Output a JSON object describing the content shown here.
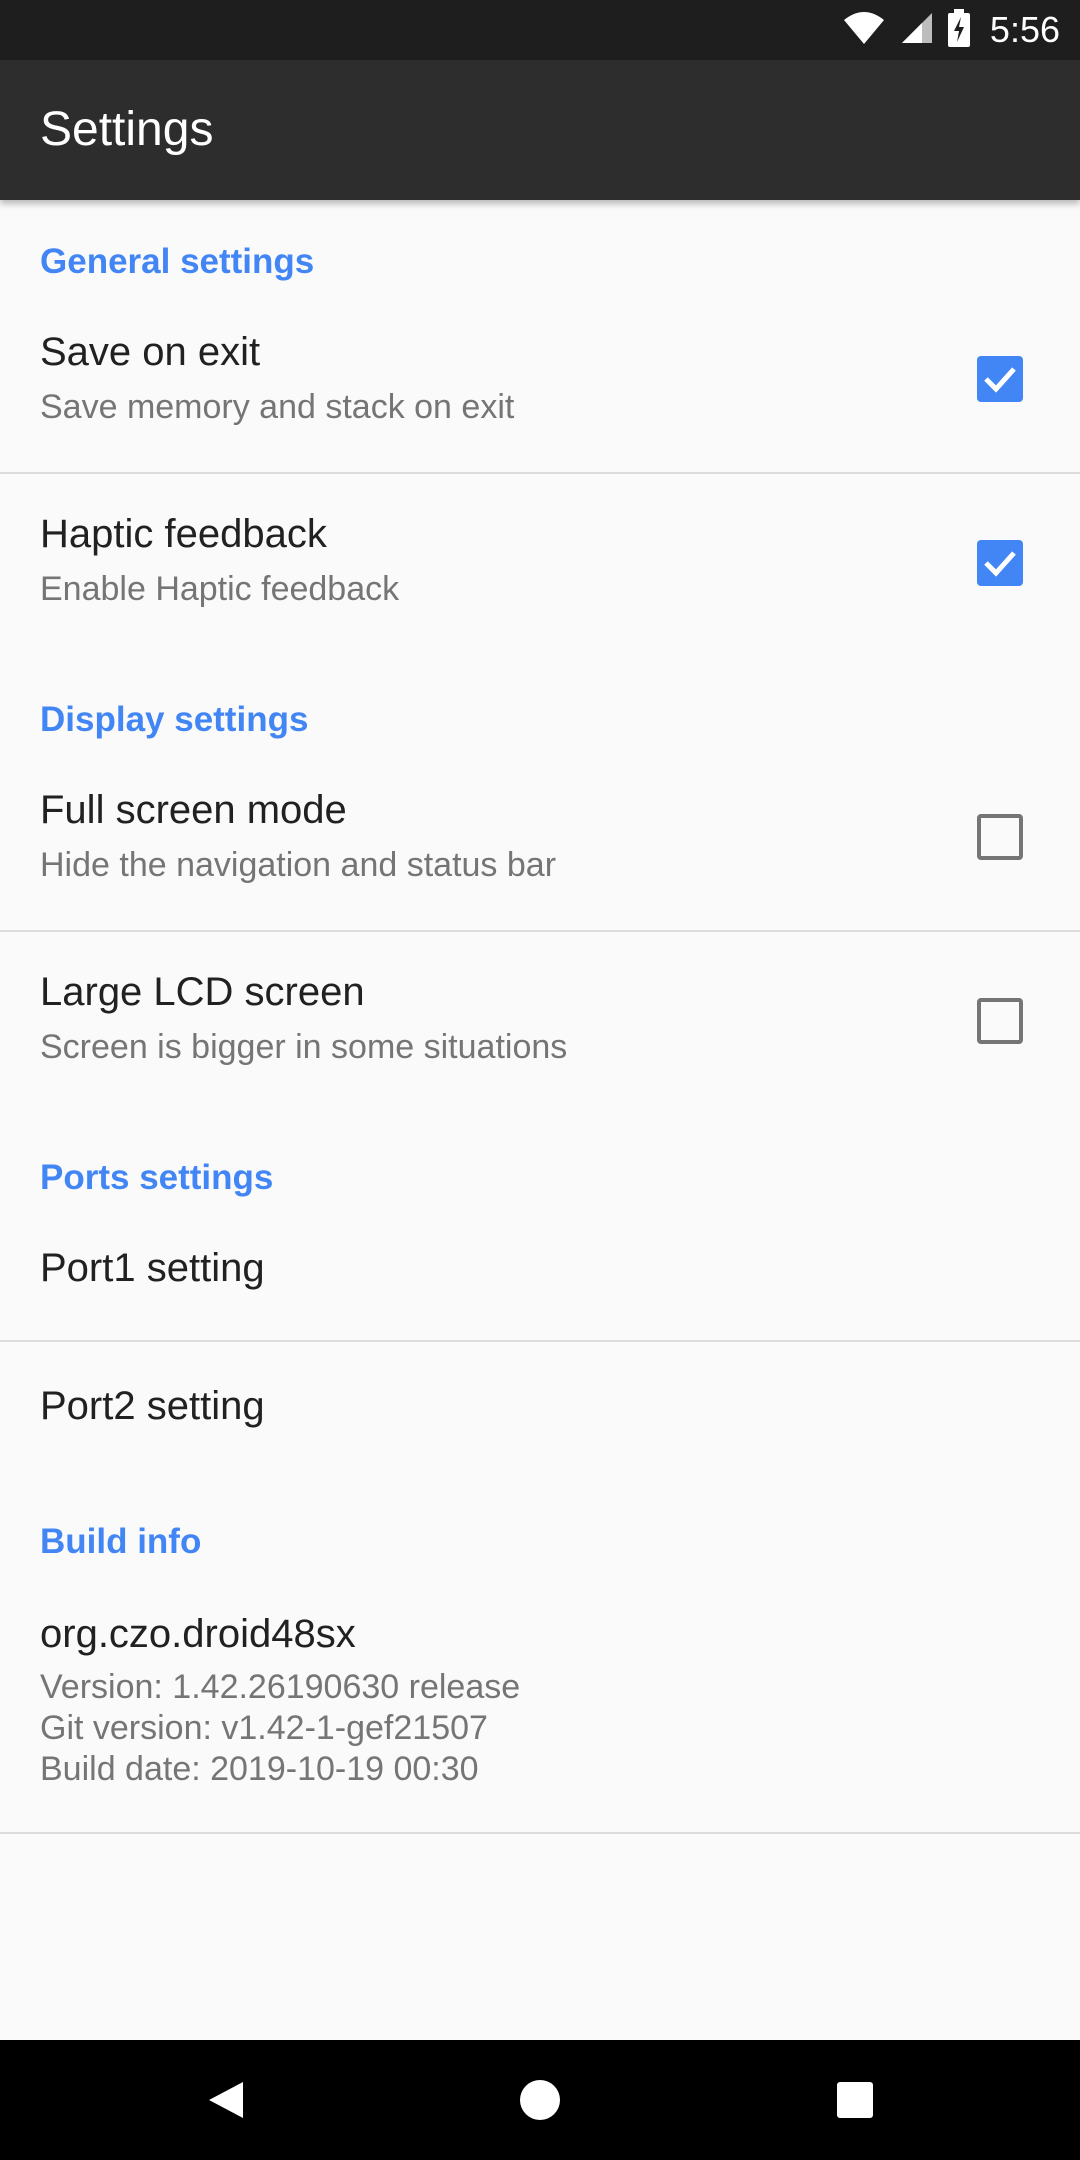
{
  "status_bar": {
    "time": "5:56",
    "icons": [
      "wifi-icon",
      "cell-signal-icon",
      "battery-charging-icon"
    ]
  },
  "app_bar": {
    "title": "Settings"
  },
  "colors": {
    "accent": "#4285f4",
    "app_bar": "#2d2d2d",
    "status_bar": "#1e1e1e",
    "background": "#fafafa"
  },
  "sections": {
    "general": {
      "header": "General settings",
      "save_on_exit": {
        "title": "Save on exit",
        "summary": "Save memory and stack on exit",
        "checked": true
      },
      "haptic": {
        "title": "Haptic feedback",
        "summary": "Enable Haptic feedback",
        "checked": true
      }
    },
    "display": {
      "header": "Display settings",
      "full_screen": {
        "title": "Full screen mode",
        "summary": "Hide the navigation and status bar",
        "checked": false
      },
      "large_lcd": {
        "title": "Large LCD screen",
        "summary": "Screen is bigger in some situations",
        "checked": false
      }
    },
    "ports": {
      "header": "Ports settings",
      "port1": {
        "title": "Port1 setting"
      },
      "port2": {
        "title": "Port2 setting"
      }
    },
    "build": {
      "header": "Build info",
      "package": "org.czo.droid48sx",
      "version": "Version: 1.42.26190630 release",
      "git_version": "Git version: v1.42-1-gef21507",
      "build_date": "Build date: 2019-10-19 00:30"
    }
  },
  "nav_bar": {
    "icons": [
      "back-icon",
      "home-icon",
      "recents-icon"
    ]
  }
}
